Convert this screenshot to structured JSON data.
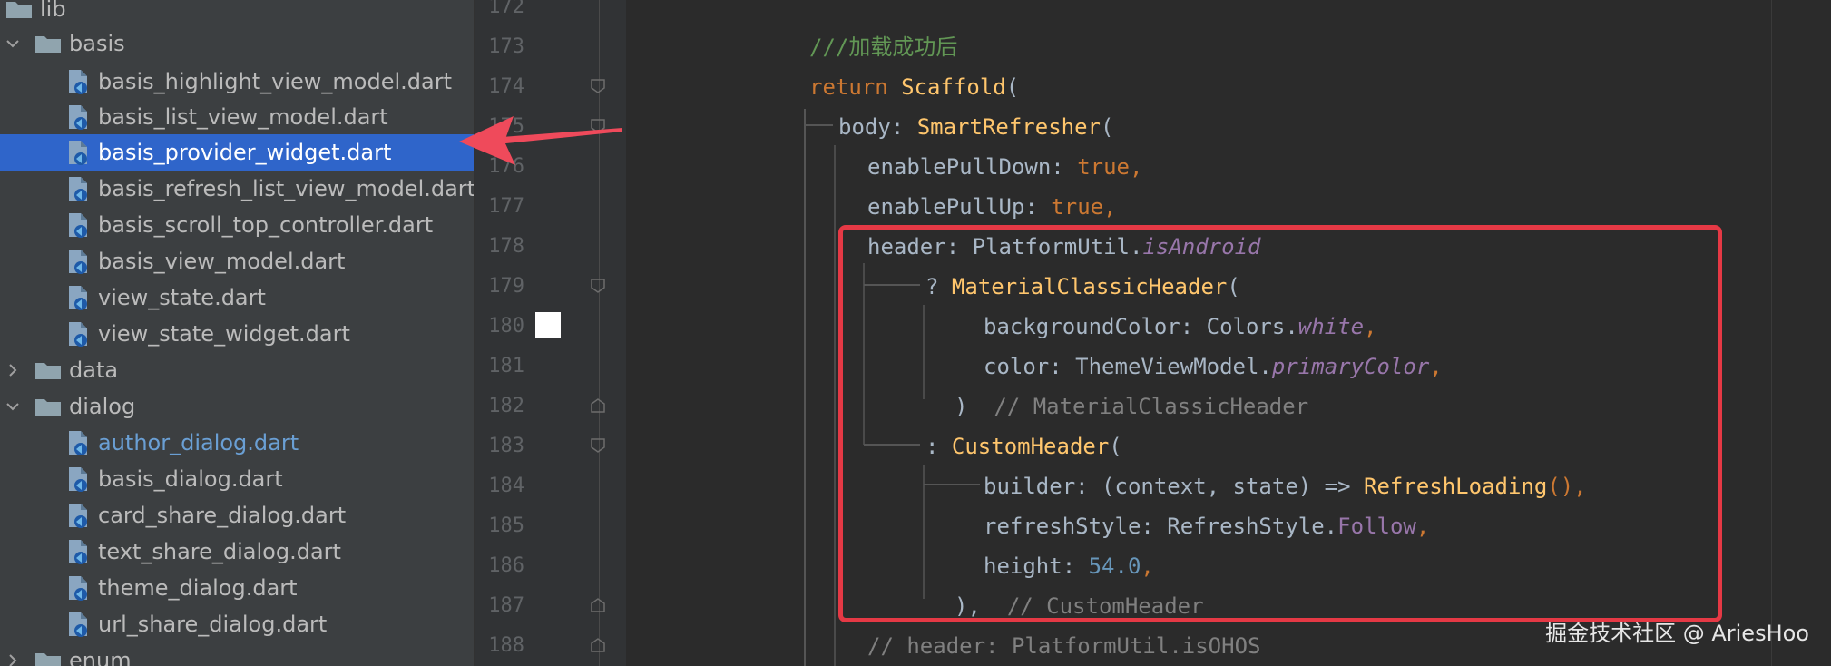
{
  "sidebar": {
    "items": [
      {
        "label": "lib",
        "kind": "folder-open"
      },
      {
        "label": "basis",
        "kind": "folder-open"
      },
      {
        "label": "basis_highlight_view_model.dart",
        "kind": "file"
      },
      {
        "label": "basis_list_view_model.dart",
        "kind": "file"
      },
      {
        "label": "basis_provider_widget.dart",
        "kind": "file",
        "selected": true
      },
      {
        "label": "basis_refresh_list_view_model.dart",
        "kind": "file"
      },
      {
        "label": "basis_scroll_top_controller.dart",
        "kind": "file"
      },
      {
        "label": "basis_view_model.dart",
        "kind": "file"
      },
      {
        "label": "view_state.dart",
        "kind": "file"
      },
      {
        "label": "view_state_widget.dart",
        "kind": "file"
      },
      {
        "label": "data",
        "kind": "folder-closed"
      },
      {
        "label": "dialog",
        "kind": "folder-open"
      },
      {
        "label": "author_dialog.dart",
        "kind": "file",
        "muted": true
      },
      {
        "label": "basis_dialog.dart",
        "kind": "file"
      },
      {
        "label": "card_share_dialog.dart",
        "kind": "file"
      },
      {
        "label": "text_share_dialog.dart",
        "kind": "file"
      },
      {
        "label": "theme_dialog.dart",
        "kind": "file"
      },
      {
        "label": "url_share_dialog.dart",
        "kind": "file"
      },
      {
        "label": "enum",
        "kind": "folder-closed"
      }
    ]
  },
  "editor": {
    "line_numbers": [
      "172",
      "173",
      "174",
      "175",
      "176",
      "177",
      "178",
      "179",
      "180",
      "181",
      "182",
      "183",
      "184",
      "185",
      "186",
      "187",
      "188"
    ],
    "code": {
      "l173": "///加载成功后",
      "l174_kw": "return",
      "l174_fn": "Scaffold",
      "l174_rest": "(",
      "l175_a": "body: ",
      "l175_fn": "SmartRefresher",
      "l175_b": "(",
      "l176_a": "enablePullDown: ",
      "l176_kw": "true",
      "l176_b": ",",
      "l177_a": "enablePullUp: ",
      "l177_kw": "true",
      "l177_b": ",",
      "l178_a": "header: PlatformUtil.",
      "l178_pp": "isAndroid",
      "l179_a": "? ",
      "l179_fn": "MaterialClassicHeader",
      "l179_b": "(",
      "l180_a": "backgroundColor: Colors.",
      "l180_pp": "white",
      "l180_b": ",",
      "l181_a": "color: ThemeViewModel.",
      "l181_pp": "primaryColor",
      "l181_b": ",",
      "l182_a": ")",
      "l182_cm": "// MaterialClassicHeader",
      "l183_a": ": ",
      "l183_fn": "CustomHeader",
      "l183_b": "(",
      "l184_a": "builder: (context, state) => ",
      "l184_fn": "RefreshLoading",
      "l184_b": "(),",
      "l185_a": "refreshStyle: RefreshStyle.",
      "l185_pl": "Follow",
      "l185_b": ",",
      "l186_a": "height: ",
      "l186_nm": "54.0",
      "l186_b": ",",
      "l187_a": "),",
      "l187_cm": "// CustomHeader",
      "l188_cm": "// header: PlatformUtil.isOHOS"
    }
  },
  "watermark": "掘金技术社区 @ AriesHoo",
  "colors": {
    "sidebar_bg": "#3c3f41",
    "editor_bg": "#2b2b2b",
    "selection": "#2f65ca",
    "highlight_box": "#e53945",
    "arrow": "#ef4a5b"
  }
}
